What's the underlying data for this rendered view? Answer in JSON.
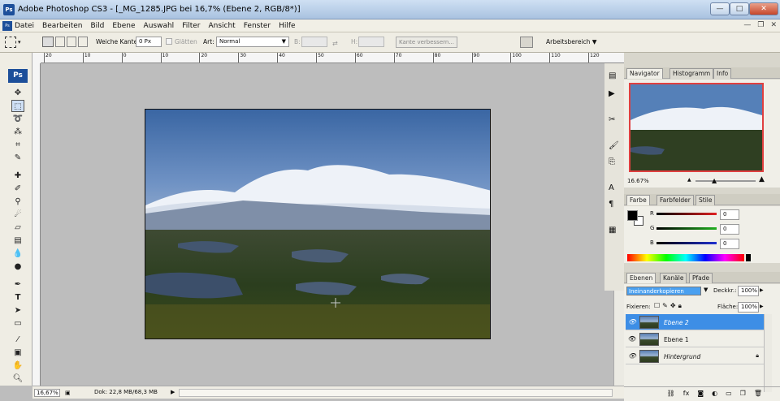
{
  "window": {
    "app_badge": "Ps",
    "title": "Adobe Photoshop CS3 - [_MG_1285.JPG bei 16,7% (Ebene 2, RGB/8*)]",
    "controls": {
      "minimize": "—",
      "maximize": "□",
      "close": "✕"
    }
  },
  "menubar": {
    "items": [
      "Datei",
      "Bearbeiten",
      "Bild",
      "Ebene",
      "Auswahl",
      "Filter",
      "Ansicht",
      "Fenster",
      "Hilfe"
    ],
    "doc_controls": {
      "minimize": "—",
      "restore": "❐",
      "close": "✕"
    }
  },
  "options": {
    "feather_label": "Weiche Kante:",
    "feather_value": "0 Px",
    "antialias_label": "Glätten",
    "style_label": "Art:",
    "style_value": "Normal",
    "width_label": "B:",
    "height_label": "H:",
    "refine_button": "Kante verbessern...",
    "workspace_label": "Arbeitsbereich"
  },
  "ruler": {
    "top_ticks": [
      "20",
      "10",
      "0",
      "10",
      "20",
      "30",
      "40",
      "50",
      "60",
      "70",
      "80",
      "90",
      "100",
      "110",
      "120"
    ]
  },
  "toolbox": {
    "logo": "Ps"
  },
  "status": {
    "zoom": "16,67%",
    "doc": "Dok: 22,8 MB/68,3 MB"
  },
  "navigator": {
    "tabs": [
      "Navigator",
      "Histogramm",
      "Info"
    ],
    "zoom": "16.67%"
  },
  "color_panel": {
    "tabs": [
      "Farbe",
      "Farbfelder",
      "Stile"
    ],
    "channels": [
      {
        "label": "R",
        "value": "0",
        "color": "#e02020"
      },
      {
        "label": "G",
        "value": "0",
        "color": "#20b020"
      },
      {
        "label": "B",
        "value": "0",
        "color": "#2030d0"
      }
    ]
  },
  "layers_panel": {
    "tabs": [
      "Ebenen",
      "Kanäle",
      "Pfade"
    ],
    "blend_mode": "Ineinanderkopieren",
    "opacity_label": "Deckkr.:",
    "opacity_value": "100%",
    "lock_label": "Fixieren:",
    "fill_label": "Fläche:",
    "fill_value": "100%",
    "layers": [
      {
        "name": "Ebene 2",
        "selected": true
      },
      {
        "name": "Ebene 1",
        "selected": false
      },
      {
        "name": "Hintergrund",
        "selected": false,
        "locked": true
      }
    ]
  },
  "colors": {
    "accent": "#3399ff",
    "selected_layer": "#3d8ee6",
    "blend_highlight": "#4aa0f0"
  }
}
